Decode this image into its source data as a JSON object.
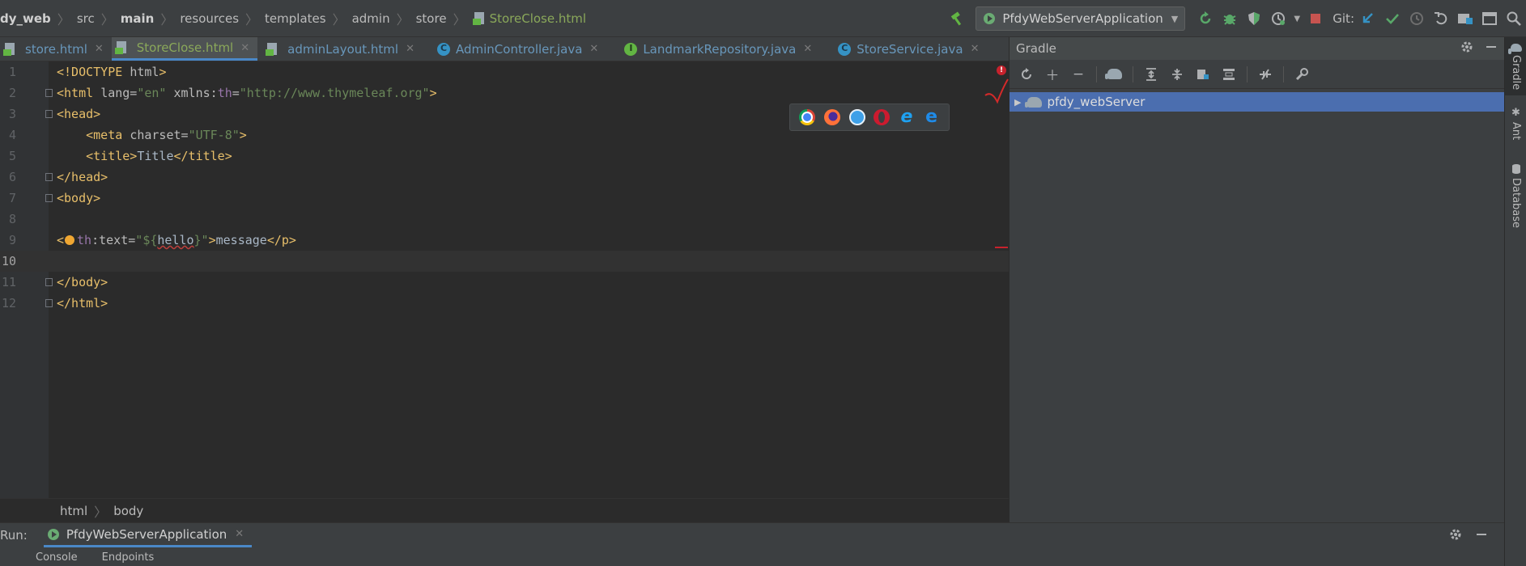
{
  "breadcrumbs": [
    {
      "label": "dy_web",
      "bold": true
    },
    {
      "label": "src"
    },
    {
      "label": "main",
      "bold": true
    },
    {
      "label": "resources"
    },
    {
      "label": "templates"
    },
    {
      "label": "admin"
    },
    {
      "label": "store"
    },
    {
      "label": "StoreClose.html",
      "file": true
    }
  ],
  "toolbar": {
    "run_config": "PfdyWebServerApplication",
    "git_label": "Git:"
  },
  "tabs": [
    {
      "label": "store.html",
      "icon": "html-file-icon",
      "active": false
    },
    {
      "label": "StoreClose.html",
      "icon": "html-file-icon",
      "active": true
    },
    {
      "label": "adminLayout.html",
      "icon": "html-file-icon",
      "active": false
    },
    {
      "label": "AdminController.java",
      "icon": "class-icon",
      "active": false
    },
    {
      "label": "LandmarkRepository.java",
      "icon": "interface-icon",
      "active": false
    },
    {
      "label": "StoreService.java",
      "icon": "class-icon",
      "active": false
    }
  ],
  "editor": {
    "line_numbers": [
      "1",
      "2",
      "3",
      "4",
      "5",
      "6",
      "7",
      "8",
      "9",
      "10",
      "11",
      "12"
    ],
    "current_line": "10",
    "error_count": "!"
  },
  "editor_breadcrumbs": [
    "html",
    "body"
  ],
  "gradle": {
    "title": "Gradle",
    "project": "pfdy_webServer"
  },
  "right_stripe": [
    "Gradle",
    "Ant",
    "Database"
  ],
  "run_panel": {
    "label": "Run:",
    "tab": "PfdyWebServerApplication",
    "subtabs": [
      "Console",
      "Endpoints"
    ]
  },
  "colors": {
    "accent": "#4a88c7",
    "selection": "#4b6eaf",
    "file_green": "#8aa85a",
    "error_red": "#c7222d"
  }
}
